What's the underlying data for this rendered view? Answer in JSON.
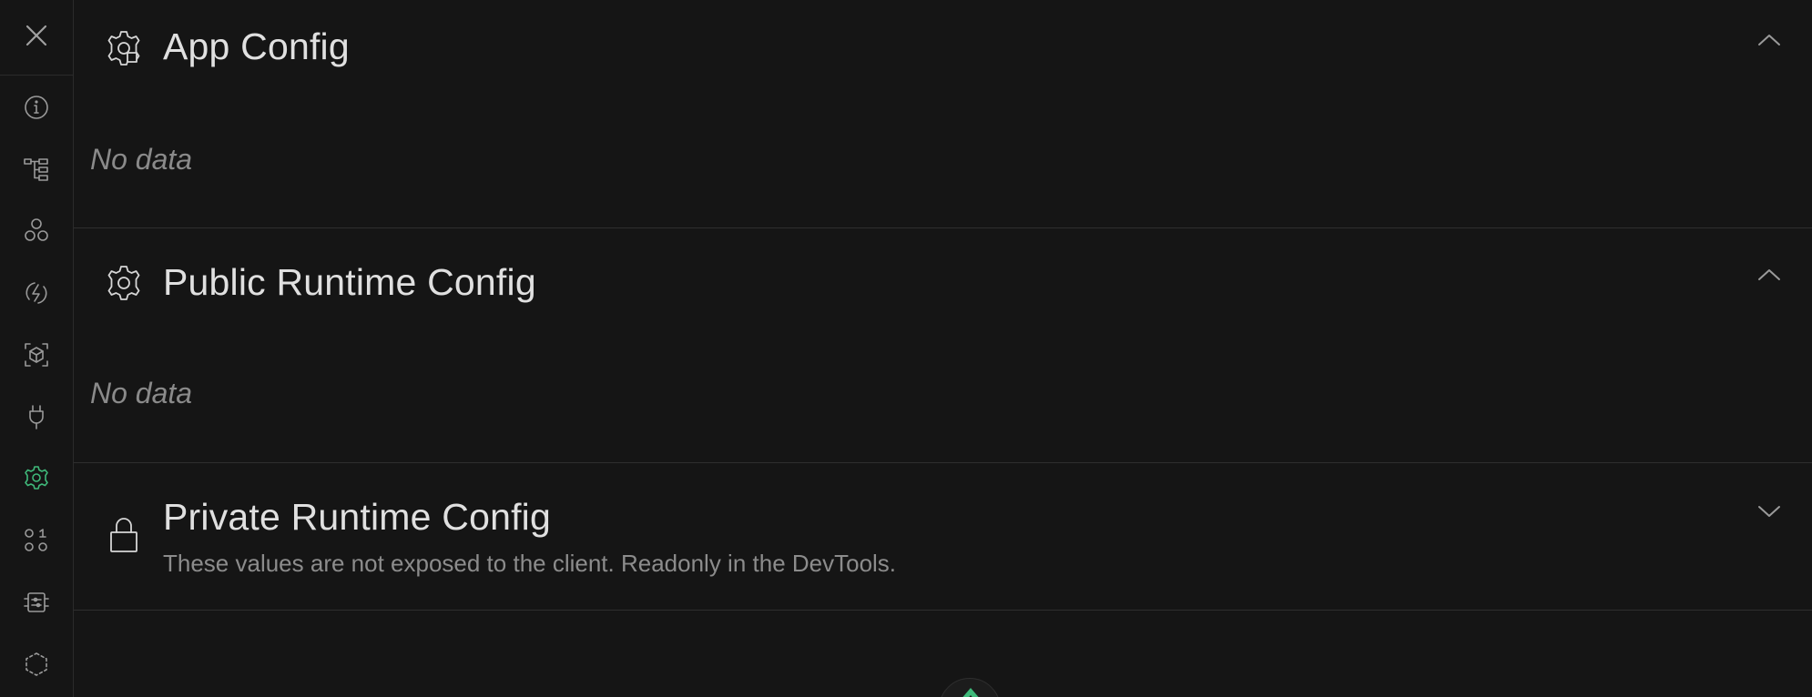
{
  "sidebar": {
    "close_icon": "close-icon",
    "items": [
      {
        "name": "overview",
        "icon": "info-icon"
      },
      {
        "name": "pages",
        "icon": "tree-icon"
      },
      {
        "name": "components",
        "icon": "components-icon"
      },
      {
        "name": "imports",
        "icon": "lightning-icon"
      },
      {
        "name": "modules",
        "icon": "cube-icon"
      },
      {
        "name": "plugins",
        "icon": "plug-icon"
      },
      {
        "name": "runtime-configs",
        "icon": "gear-icon",
        "active": true
      },
      {
        "name": "payload",
        "icon": "payload-icon"
      },
      {
        "name": "server-routes",
        "icon": "server-routes-icon"
      },
      {
        "name": "virtual-files",
        "icon": "dashed-hexagon-icon"
      }
    ],
    "active_color": "#3fb97a"
  },
  "sections": {
    "app_config": {
      "title": "App Config",
      "empty_text": "No data",
      "expanded": true
    },
    "public_runtime": {
      "title": "Public Runtime Config",
      "empty_text": "No data",
      "expanded": true
    },
    "private_runtime": {
      "title": "Private Runtime Config",
      "subtitle": "These values are not exposed to the client. Readonly in the DevTools.",
      "expanded": false
    }
  }
}
